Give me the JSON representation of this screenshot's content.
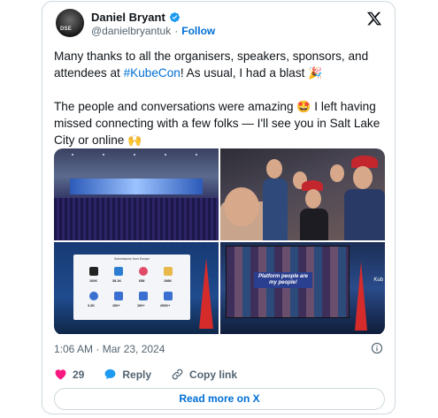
{
  "author": {
    "name": "Daniel Bryant",
    "handle": "@danielbryantuk",
    "separator": "·",
    "follow_label": "Follow",
    "avatar_text": "DSE"
  },
  "tweet": {
    "para1_before": "Many thanks to all the organisers, speakers, sponsors, and attendees at ",
    "hashtag": "#KubeCon",
    "para1_after": "! As usual, I had a blast ",
    "para1_emoji": "🎉",
    "para2_before": "The people and conversations were amazing ",
    "para2_emoji": "🤩",
    "para2_after": " I left having missed connecting with a few folks — I'll see you in Salt Lake City or online ",
    "para2_emoji_end": "🙌"
  },
  "media": {
    "slide_title": "Submissions from Europe",
    "slide_numbers": [
      "100K",
      "38.1K",
      "658",
      "198K",
      "3.2K",
      "100+",
      "100+",
      "200K+"
    ],
    "photo4_caption": "Platform people are my people!",
    "photo4_side": "Kub"
  },
  "meta": {
    "timestamp": "1:06 AM · Mar 23, 2024"
  },
  "actions": {
    "like_count": "29",
    "reply_label": "Reply",
    "copy_link_label": "Copy link"
  },
  "read_more_label": "Read more on X",
  "colors": {
    "link_blue": "#006fd6",
    "like_pink": "#f91880",
    "secondary_text": "#536471",
    "border": "#cfd9de"
  }
}
